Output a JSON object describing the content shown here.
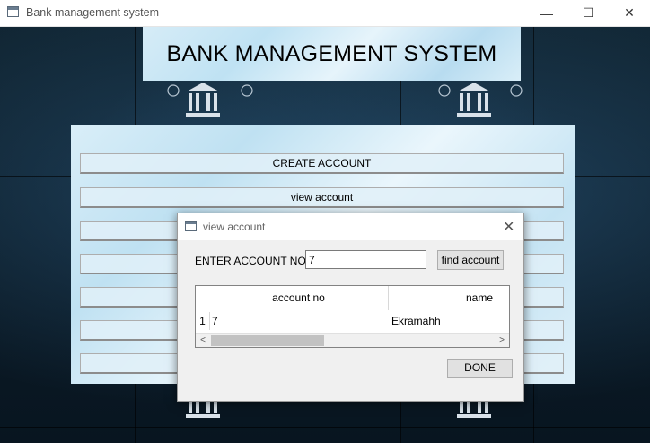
{
  "window": {
    "title": "Bank management system",
    "minimize_glyph": "—",
    "maximize_glyph": "☐",
    "close_glyph": "✕"
  },
  "banner": {
    "title": "BANK MANAGEMENT SYSTEM"
  },
  "menu": {
    "items": [
      {
        "label": "CREATE ACCOUNT"
      },
      {
        "label": "view account"
      },
      {
        "label": ""
      },
      {
        "label": ""
      },
      {
        "label": ""
      },
      {
        "label": ""
      },
      {
        "label": ""
      }
    ]
  },
  "dialog": {
    "title": "view account",
    "close_glyph": "✕",
    "account_label": "ENTER ACCOUNT NO:",
    "account_value": "7",
    "find_button": "find account",
    "table": {
      "columns": [
        "account no",
        "name"
      ],
      "rows": [
        {
          "num": "1",
          "cells": [
            "7",
            "Ekramahh"
          ]
        }
      ]
    },
    "scroll_left_glyph": "<",
    "scroll_right_glyph": ">",
    "done_button": "DONE"
  },
  "icons": {
    "app": "window-app-icon",
    "bank": "bank-building-icon",
    "coin": "bitcoin-coin-icon"
  }
}
